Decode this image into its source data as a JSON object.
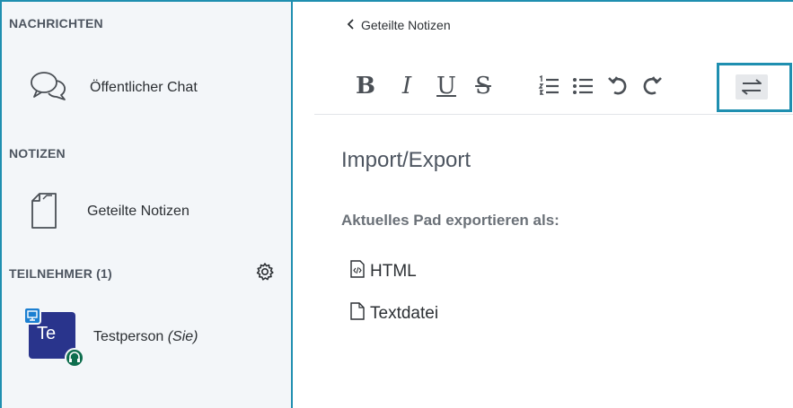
{
  "sidebar": {
    "messages_title": "NACHRICHTEN",
    "public_chat_label": "Öffentlicher Chat",
    "notes_title": "NOTIZEN",
    "shared_notes_label": "Geteilte Notizen",
    "participants_title": "TEILNEHMER (1)",
    "user": {
      "initials": "Te",
      "name": "Testperson",
      "self_tag": "(Sie)"
    }
  },
  "main": {
    "back_label": "Geteilte Notizen",
    "heading": "Import/Export",
    "subheading": "Aktuelles Pad exportieren als:",
    "export_options": [
      {
        "label": "HTML",
        "icon": "html-file-icon"
      },
      {
        "label": "Textdatei",
        "icon": "text-file-icon"
      }
    ]
  },
  "toolbar": {
    "bold": "B",
    "italic": "I",
    "underline": "U",
    "strike": "S",
    "icons": [
      "ordered-list-icon",
      "unordered-list-icon",
      "undo-icon",
      "redo-icon",
      "import-export-icon"
    ]
  },
  "colors": {
    "accent": "#1f8fb0",
    "avatar": "#29348c",
    "sidebar_bg": "#f3f6f9"
  }
}
